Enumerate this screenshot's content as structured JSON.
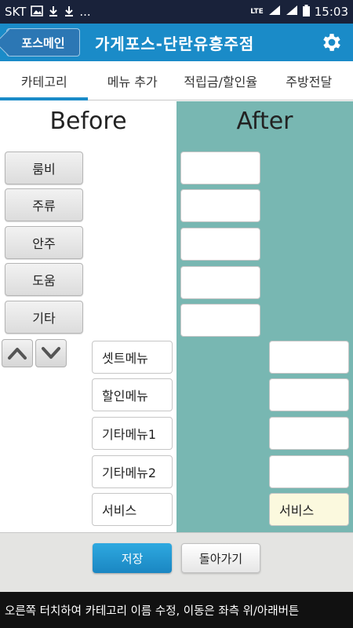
{
  "status_bar": {
    "carrier": "SKT",
    "dots": "...",
    "network": "LTE",
    "time": "15:03"
  },
  "header": {
    "back_label": "포스메인",
    "title": "가게포스-단란유흥주점"
  },
  "tabs": [
    {
      "label": "카테고리",
      "active": true
    },
    {
      "label": "메뉴 추가",
      "active": false
    },
    {
      "label": "적립금/할인율",
      "active": false
    },
    {
      "label": "주방전달",
      "active": false
    }
  ],
  "before": {
    "title": "Before",
    "categories": [
      "룸비",
      "주류",
      "안주",
      "도움",
      "기타"
    ],
    "menus": [
      "셋트메뉴",
      "할인메뉴",
      "기타메뉴1",
      "기타메뉴2",
      "서비스"
    ]
  },
  "after": {
    "title": "After",
    "category_slots": [
      "",
      "",
      "",
      "",
      ""
    ],
    "menu_slots": [
      "",
      "",
      "",
      "",
      "서비스"
    ]
  },
  "buttons": {
    "save": "저장",
    "back": "돌아가기"
  },
  "hint": "오른쪽 터치하여 카테고리 이름 수정, 이동은 좌측 위/아래버튼",
  "colors": {
    "header": "#1a8bc8",
    "status_bar": "#19223a",
    "after_panel": "#78b7b2",
    "filled_slot": "#fbf9de"
  }
}
